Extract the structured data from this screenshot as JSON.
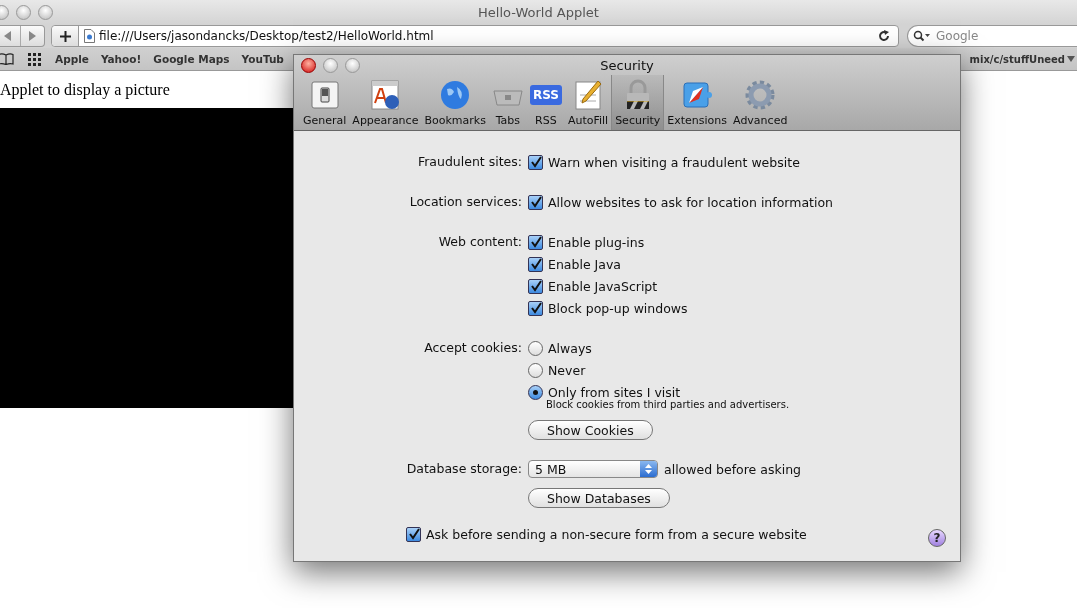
{
  "browser": {
    "title": "Hello-World Applet",
    "address": "file:///Users/jasondancks/Desktop/test2/HelloWorld.html",
    "search": {
      "placeholder": "Google"
    },
    "bookmarks": [
      "Apple",
      "Yahoo!",
      "Google Maps",
      "YouTub"
    ],
    "bookmarks_overflow": "mix/c/stuffUneed",
    "page_text": "Applet to display a picture"
  },
  "dialog": {
    "title": "Security",
    "tabs": [
      {
        "label": "General",
        "selected": false
      },
      {
        "label": "Appearance",
        "selected": false
      },
      {
        "label": "Bookmarks",
        "selected": false
      },
      {
        "label": "Tabs",
        "selected": false
      },
      {
        "label": "RSS",
        "icon_text": "RSS",
        "selected": false
      },
      {
        "label": "AutoFill",
        "selected": false
      },
      {
        "label": "Security",
        "selected": true
      },
      {
        "label": "Extensions",
        "selected": false
      },
      {
        "label": "Advanced",
        "selected": false
      }
    ],
    "sections": [
      {
        "label": "Fraudulent sites:",
        "items": [
          {
            "kind": "checkbox",
            "label": "Warn when visiting a fraudulent website",
            "checked": true
          }
        ]
      },
      {
        "label": "Location services:",
        "items": [
          {
            "kind": "checkbox",
            "label": "Allow websites to ask for location information",
            "checked": true
          }
        ]
      },
      {
        "label": "Web content:",
        "items": [
          {
            "kind": "checkbox",
            "label": "Enable plug-ins",
            "checked": true
          },
          {
            "kind": "checkbox",
            "label": "Enable Java",
            "checked": true
          },
          {
            "kind": "checkbox",
            "label": "Enable JavaScript",
            "checked": true
          },
          {
            "kind": "checkbox",
            "label": "Block pop-up windows",
            "checked": true
          }
        ]
      },
      {
        "label": "Accept cookies:",
        "items": [
          {
            "kind": "radio",
            "label": "Always",
            "selected": false
          },
          {
            "kind": "radio",
            "label": "Never",
            "selected": false
          },
          {
            "kind": "radio",
            "label": "Only from sites I visit",
            "selected": true
          },
          {
            "kind": "note",
            "label": "Block cookies from third parties and advertisers."
          },
          {
            "kind": "button",
            "label": "Show Cookies"
          }
        ]
      },
      {
        "label": "Database storage:",
        "items": [
          {
            "kind": "select",
            "label": "5 MB",
            "suffix": "allowed before asking"
          },
          {
            "kind": "button",
            "label": "Show Databases"
          }
        ]
      }
    ],
    "footer_checkbox": {
      "label": "Ask before sending a non-secure form from a secure website",
      "checked": true
    },
    "help": "?"
  }
}
